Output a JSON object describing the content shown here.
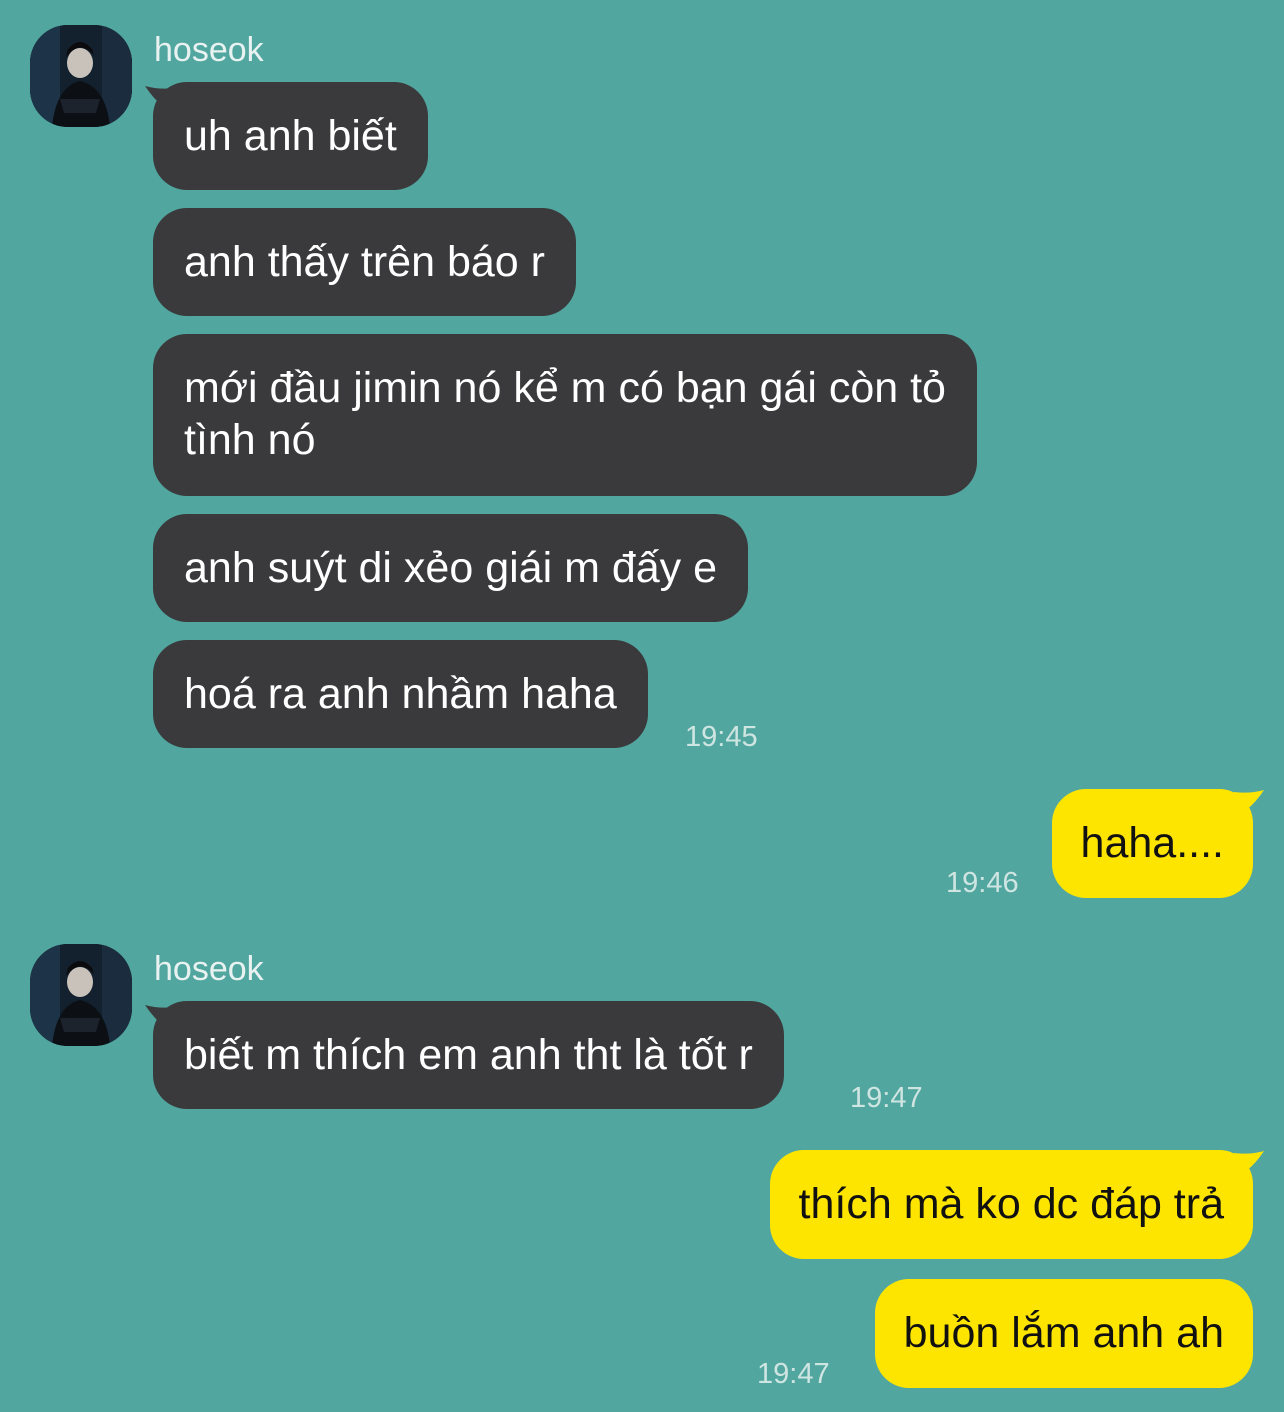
{
  "sender_name": "hoseok",
  "groups": [
    {
      "sender": "hoseok",
      "messages": [
        "uh anh biết",
        "anh thấy trên báo r",
        [
          "mới đầu jimin nó kể m có bạn gái còn tỏ",
          "tình nó"
        ],
        "anh suýt di xẻo giái m đấy e",
        "hoá ra anh nhầm haha"
      ],
      "time": "19:45"
    },
    {
      "sender": "me",
      "messages": [
        "haha...."
      ],
      "time": "19:46"
    },
    {
      "sender": "hoseok",
      "messages": [
        "biết m thích em anh tht là tốt r"
      ],
      "time": "19:47"
    },
    {
      "sender": "me",
      "messages": [
        "thích mà ko dc đáp trả",
        "buồn lắm anh ah"
      ],
      "time": "19:47"
    }
  ],
  "colors": {
    "background": "#52a6a0",
    "incoming_bubble": "#3a3a3c",
    "outgoing_bubble": "#fee500"
  },
  "icons": {
    "avatar": "profile-photo"
  }
}
